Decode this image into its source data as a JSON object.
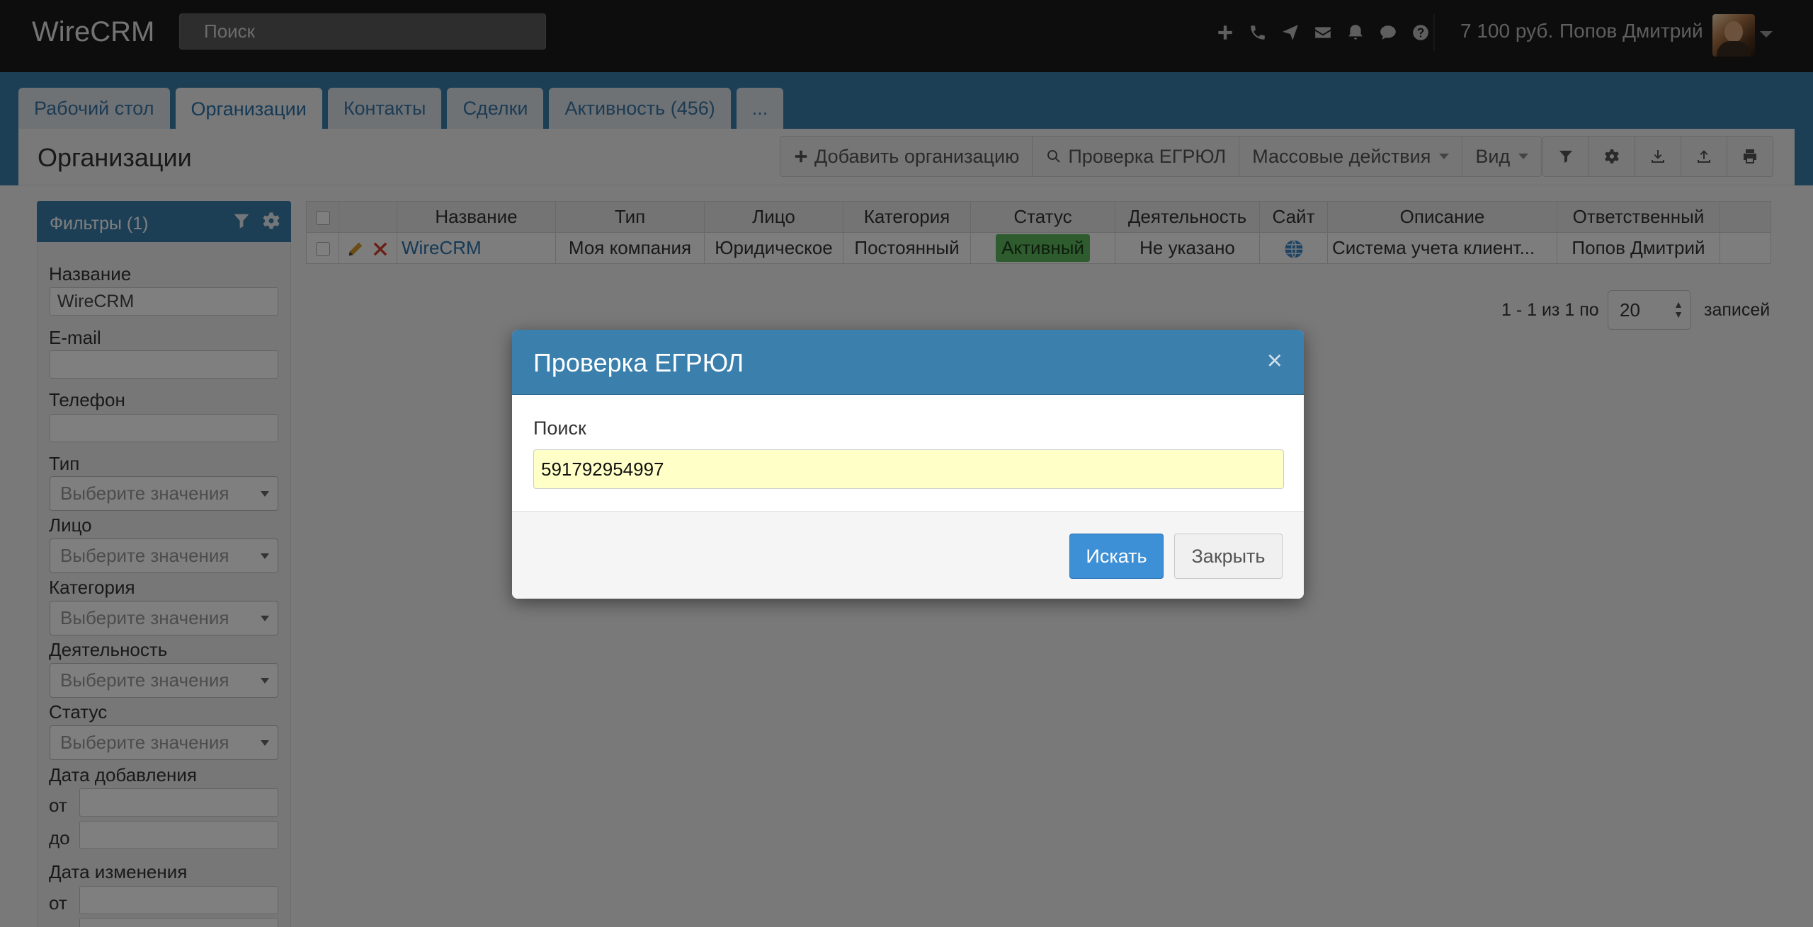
{
  "navbar": {
    "brand": "WireCRM",
    "search_placeholder": "Поиск",
    "icons": [
      "plus-icon",
      "phone-icon",
      "paper-plane-icon",
      "envelope-icon",
      "bell-icon",
      "chat-icon",
      "help-icon"
    ],
    "balance": "7 100 руб.",
    "user_name": "Попов Дмитрий"
  },
  "tabs": [
    {
      "label": "Рабочий стол",
      "active": false
    },
    {
      "label": "Организации",
      "active": true
    },
    {
      "label": "Контакты",
      "active": false
    },
    {
      "label": "Сделки",
      "active": false
    },
    {
      "label": "Активность (456)",
      "active": false
    },
    {
      "label": "...",
      "active": false
    }
  ],
  "page": {
    "title": "Организации",
    "toolbar": {
      "add_label": "Добавить организацию",
      "egrul_label": "Проверка ЕГРЮЛ",
      "mass_label": "Массовые действия",
      "view_label": "Вид"
    }
  },
  "filters": {
    "title": "Фильтры (1)",
    "name_label": "Название",
    "name_value": "WireCRM",
    "email_label": "E-mail",
    "phone_label": "Телефон",
    "type_label": "Тип",
    "face_label": "Лицо",
    "category_label": "Категория",
    "activity_label": "Деятельность",
    "status_label": "Статус",
    "select_placeholder": "Выберите значения",
    "date_added_label": "Дата добавления",
    "date_changed_label": "Дата изменения",
    "from_label": "от",
    "to_label": "до"
  },
  "table": {
    "headers": [
      "Название",
      "Тип",
      "Лицо",
      "Категория",
      "Статус",
      "Деятельность",
      "Сайт",
      "Описание",
      "Ответственный"
    ],
    "rows": [
      {
        "name": "WireCRM",
        "type": "Моя компания",
        "face": "Юридическое",
        "category": "Постоянный",
        "status": "Активный",
        "activity": "Не указано",
        "description": "Система учета клиент...",
        "responsible": "Попов Дмитрий"
      }
    ]
  },
  "pager": {
    "range_text": "1 - 1 из 1 по",
    "per_page": "20",
    "suffix": "записей"
  },
  "modal": {
    "title": "Проверка ЕГРЮЛ",
    "close": "×",
    "search_label": "Поиск",
    "search_value": "591792954997",
    "submit_label": "Искать",
    "close_label": "Закрыть"
  },
  "colors": {
    "navbar_bg": "#1b1b1b",
    "brand_blue": "#3b7fad",
    "status_green": "#5cb85c",
    "primary_button": "#3d8fd6",
    "input_highlight": "#ffffc8"
  }
}
